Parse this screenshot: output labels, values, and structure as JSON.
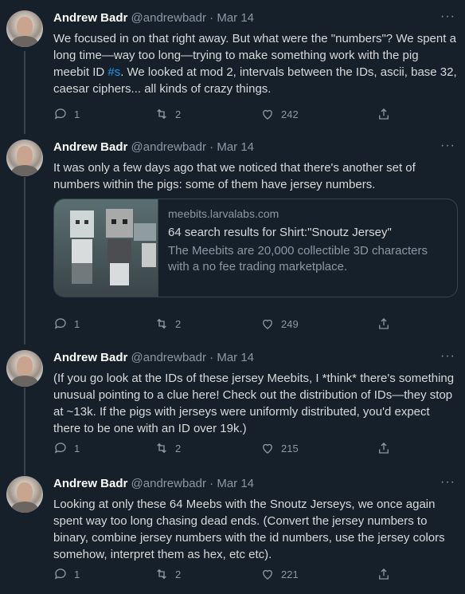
{
  "tweets": [
    {
      "name": "Andrew Badr",
      "handle": "@andrewbadr",
      "sep": "·",
      "date": "Mar 14",
      "text_before": "We focused in on that right away. But what were the \"numbers\"? We spent a long time—way too long—trying to make something work with the pig meebit ID ",
      "hashtag": "#s",
      "text_after": ". We looked at mod 2, intervals between the IDs, ascii, base 32, caesar ciphers... all kinds of crazy things.",
      "replies": "1",
      "retweets": "2",
      "likes": "242"
    },
    {
      "name": "Andrew Badr",
      "handle": "@andrewbadr",
      "sep": "·",
      "date": "Mar 14",
      "text": "It was only a few days ago that we noticed that there's another set of numbers within the pigs: some of them have jersey numbers.",
      "card": {
        "domain": "meebits.larvalabs.com",
        "title": "64 search results for Shirt:\"Snoutz Jersey\"",
        "description": "The Meebits are 20,000 collectible 3D characters with a no fee trading marketplace."
      },
      "replies": "1",
      "retweets": "2",
      "likes": "249"
    },
    {
      "name": "Andrew Badr",
      "handle": "@andrewbadr",
      "sep": "·",
      "date": "Mar 14",
      "text": "(If you go look at the IDs of these jersey Meebits, I *think* there's something unusual pointing to a clue here! Check out the distribution of IDs—they stop at ~13k. If the pigs with jerseys were uniformly distributed, you'd expect there to be one with an ID over 19k.)",
      "replies": "1",
      "retweets": "2",
      "likes": "215"
    },
    {
      "name": "Andrew Badr",
      "handle": "@andrewbadr",
      "sep": "·",
      "date": "Mar 14",
      "text": "Looking at only these 64 Meebs with the Snoutz Jerseys, we once again spent way too long chasing dead ends. (Convert the jersey numbers to binary, combine jersey numbers with the id numbers, use the jersey colors somehow, interpret them as hex, etc etc).",
      "replies": "1",
      "retweets": "2",
      "likes": "221"
    }
  ],
  "more_glyph": "···",
  "icons": {
    "reply": "reply-icon",
    "retweet": "retweet-icon",
    "like": "like-icon",
    "share": "share-icon"
  },
  "colors": {
    "background": "#15202b",
    "text": "#d9d9d9",
    "secondary": "#8b98a5",
    "accent": "#1d9bf0",
    "border": "#38444d"
  }
}
